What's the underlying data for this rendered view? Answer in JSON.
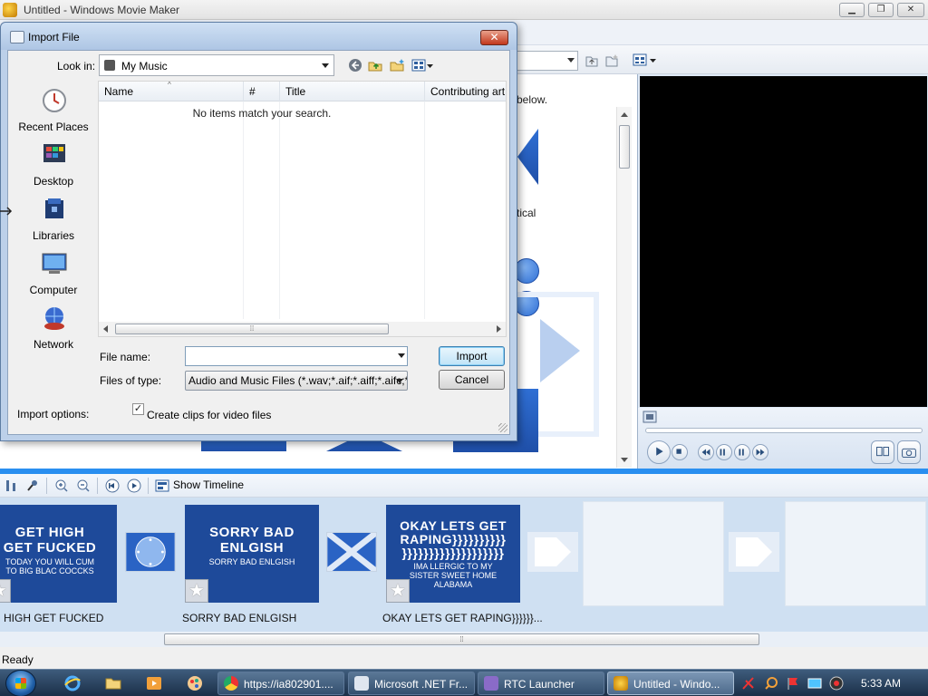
{
  "window": {
    "title": "Untitled - Windows Movie Maker",
    "min_label": "▁",
    "max_label": "❐",
    "close_label": "✕"
  },
  "tasks": {
    "text_below": "below.",
    "text_tical": "tical"
  },
  "dialog": {
    "title": "Import File",
    "close_label": "✕",
    "look_in_label": "Look in:",
    "look_in_value": "My Music",
    "places": [
      {
        "label": "Recent Places",
        "icon": "clock-icon"
      },
      {
        "label": "Desktop",
        "icon": "desktop-icon"
      },
      {
        "label": "Libraries",
        "icon": "libraries-icon"
      },
      {
        "label": "Computer",
        "icon": "computer-icon"
      },
      {
        "label": "Network",
        "icon": "network-icon"
      }
    ],
    "columns": [
      "Name",
      "#",
      "Title",
      "Contributing art"
    ],
    "empty_message": "No items match your search.",
    "file_name_label": "File name:",
    "file_name_value": "",
    "files_of_type_label": "Files of type:",
    "files_of_type_value": "Audio and Music Files (*.wav;*.aif;*.aiff;*.aifc;*.s",
    "import_button": "Import",
    "cancel_button": "Cancel",
    "import_options_label": "Import options:",
    "create_clips_label": "Create clips for video files",
    "create_clips_checked": true
  },
  "storyboard_toolbar": {
    "show_timeline": "Show Timeline"
  },
  "clips": [
    {
      "big": "GET HIGH\nGET FUCKED",
      "small": "TODAY YOU WILL CUM\nTO BIG BLAC COCCKS",
      "label": "HIGH GET FUCKED"
    },
    {
      "big": "SORRY BAD\nENLGISH",
      "small": "SORRY BAD ENLGISH",
      "label": "SORRY BAD ENLGISH"
    },
    {
      "big": "OKAY LETS GET\nRAPING}}}}}}}}}}\n}}}}}}}}}}}}}}}}}}}",
      "small": "IMA LLERGIC TO MY\nSISTER SWEET HOME\nALABAMA",
      "label": "OKAY LETS GET RAPING}}}}}}..."
    }
  ],
  "status": {
    "text": "Ready"
  },
  "taskbar": {
    "buttons": [
      {
        "label": "https://ia802901....",
        "icon": "chrome-icon"
      },
      {
        "label": "Microsoft .NET Fr...",
        "icon": "dotnet-icon"
      },
      {
        "label": "RTC Launcher",
        "icon": "rtc-icon"
      },
      {
        "label": "Untitled - Windo...",
        "icon": "moviemaker-icon"
      }
    ],
    "clock": "5:33 AM"
  },
  "colors": {
    "accent": "#2a8ff0",
    "clip_blue": "#1e4a9a",
    "dialog_frame": "#bcd0e9"
  }
}
